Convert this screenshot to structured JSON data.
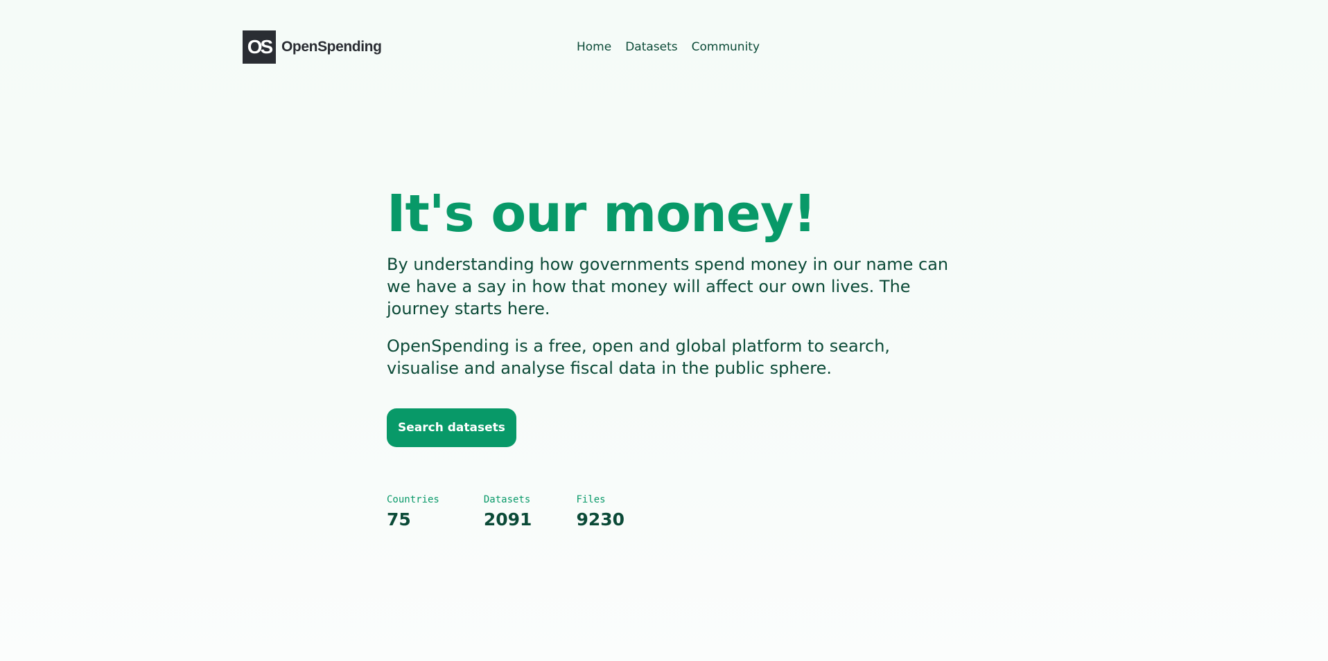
{
  "brand": {
    "mark": "OS",
    "name": "OpenSpending"
  },
  "nav": {
    "items": [
      {
        "label": "Home"
      },
      {
        "label": "Datasets"
      },
      {
        "label": "Community"
      }
    ]
  },
  "hero": {
    "title": "It's our money!",
    "paragraph1": "By understanding how governments spend money in our name can we have a say in how that money will affect our own lives. The journey starts here.",
    "paragraph2": "OpenSpending is a free, open and global platform to search, visualise and analyse fiscal data in the public sphere.",
    "cta_label": "Search datasets"
  },
  "stats": [
    {
      "label": "Countries",
      "value": "75"
    },
    {
      "label": "Datasets",
      "value": "2091"
    },
    {
      "label": "Files",
      "value": "9230"
    }
  ],
  "colors": {
    "accent": "#089968",
    "text": "#0b4a37",
    "logo_bg": "#2a2d33",
    "background": "#f5fbf8"
  }
}
